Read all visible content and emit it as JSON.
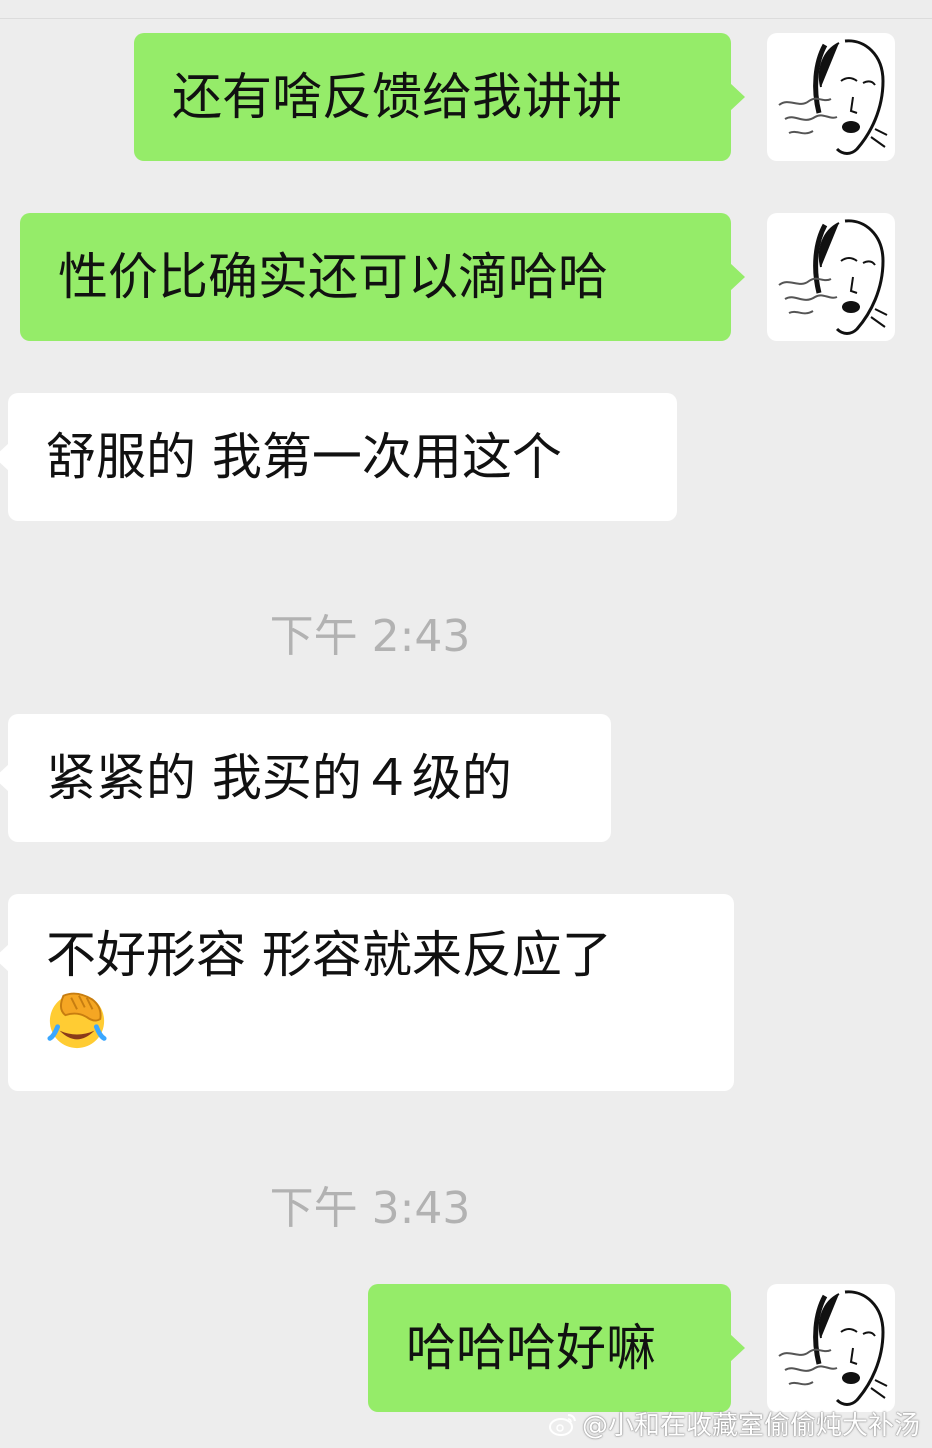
{
  "messages": [
    {
      "side": "out",
      "text": "还有啥反馈给我讲讲"
    },
    {
      "side": "out",
      "text": "性价比确实还可以滴哈哈"
    },
    {
      "side": "in",
      "text": "舒服的 我第一次用这个"
    },
    {
      "side": "in",
      "text": "紧紧的 我买的４级的"
    },
    {
      "side": "in",
      "text": "不好形容 形容就来反应了",
      "emoji": "facepalm-laughing-emoji"
    },
    {
      "side": "out",
      "text": "哈哈哈好嘛"
    }
  ],
  "timestamps": [
    "下午 2:43",
    "下午 3:43"
  ],
  "watermark": {
    "text": "@小和在收藏室偷偷炖大补汤"
  },
  "colors": {
    "background": "#ededed",
    "outgoing_bubble": "#95ec69",
    "incoming_bubble": "#ffffff",
    "timestamp": "#b2b2b2"
  },
  "icons": [
    "avatar-sketch-face",
    "weibo-icon",
    "facepalm-laughing-emoji"
  ]
}
